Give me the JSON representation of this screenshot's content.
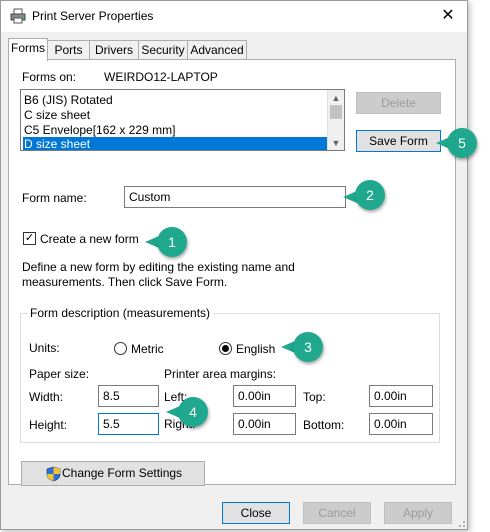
{
  "window": {
    "title": "Print Server Properties",
    "close_glyph": "✕"
  },
  "tabs": [
    {
      "label": "Forms",
      "active": true
    },
    {
      "label": "Ports"
    },
    {
      "label": "Drivers"
    },
    {
      "label": "Security"
    },
    {
      "label": "Advanced"
    }
  ],
  "forms_on": {
    "label": "Forms on:",
    "value": "WEIRDO12-LAPTOP"
  },
  "forms_list": {
    "items": [
      "B6 (JIS) Rotated",
      "C size sheet",
      "C5 Envelope[162 x 229 mm]",
      "D size sheet"
    ],
    "selected_index": 3
  },
  "buttons": {
    "delete": "Delete",
    "save_form": "Save Form",
    "change_form_settings": "Change Form Settings",
    "close": "Close",
    "cancel": "Cancel",
    "apply": "Apply"
  },
  "form_name": {
    "label": "Form name:",
    "value": "Custom"
  },
  "create_new": {
    "label": "Create a new form",
    "checked": true
  },
  "description": {
    "line1": "Define a new form by editing the existing name and",
    "line2": "measurements. Then click Save Form."
  },
  "measurements": {
    "title": "Form description (measurements)",
    "units_label": "Units:",
    "metric_label": "Metric",
    "english_label": "English",
    "selected_unit": "English",
    "paper_size_label": "Paper size:",
    "printer_margins_label": "Printer area margins:",
    "width_label": "Width:",
    "width_value": "8.5",
    "height_label": "Height:",
    "height_value": "5.5",
    "left_label": "Left:",
    "left_value": "0.00in",
    "right_label": "Right:",
    "right_value": "0.00in",
    "top_label": "Top:",
    "top_value": "0.00in",
    "bottom_label": "Bottom:",
    "bottom_value": "0.00in"
  },
  "callouts": [
    "1",
    "2",
    "3",
    "4",
    "5"
  ],
  "colors": {
    "accent": "#0078d7",
    "callout": "#1fa88e"
  }
}
